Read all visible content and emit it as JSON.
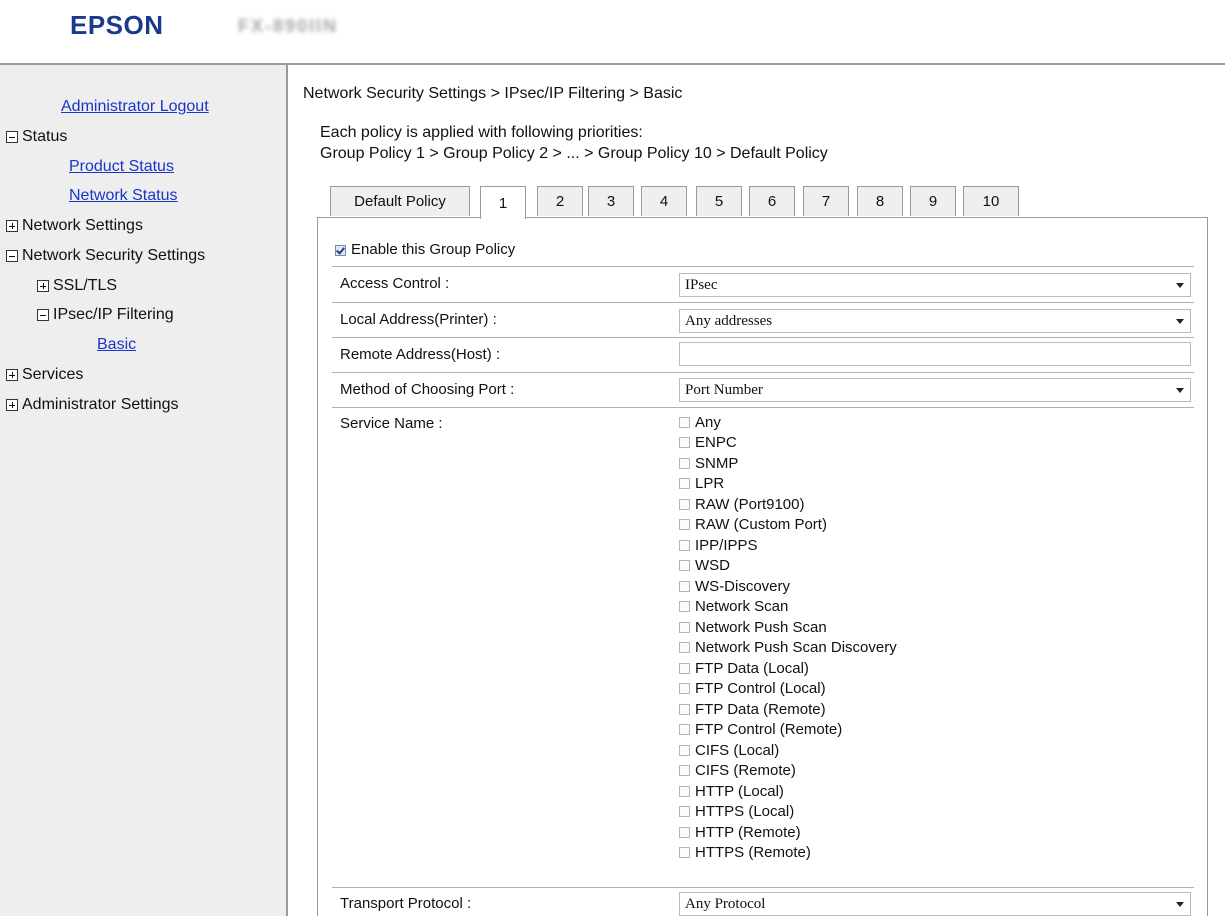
{
  "header": {
    "brand": "EPSON",
    "model": "FX-890IIN"
  },
  "sidebar": {
    "logout": "Administrator Logout",
    "items": [
      {
        "label": "Status"
      },
      {
        "label": "Product Status"
      },
      {
        "label": "Network Status"
      },
      {
        "label": "Network Settings"
      },
      {
        "label": "Network Security Settings"
      },
      {
        "label": "SSL/TLS"
      },
      {
        "label": "IPsec/IP Filtering"
      },
      {
        "label": "Basic"
      },
      {
        "label": "Services"
      },
      {
        "label": "Administrator Settings"
      }
    ]
  },
  "main": {
    "breadcrumb": "Network Security Settings > IPsec/IP Filtering > Basic",
    "intro1": "Each policy is applied with following priorities:",
    "intro2": "Group Policy 1 > Group Policy 2 > ... > Group Policy 10 > Default Policy",
    "tabs": [
      "Default Policy",
      "1",
      "2",
      "3",
      "4",
      "5",
      "6",
      "7",
      "8",
      "9",
      "10"
    ],
    "active_tab": "1",
    "enable_label": "Enable this Group Policy",
    "enable_checked": true,
    "access_control": {
      "label": "Access Control :",
      "value": "IPsec"
    },
    "local_address": {
      "label": "Local Address(Printer) :",
      "value": "Any addresses"
    },
    "remote_address": {
      "label": "Remote Address(Host) :",
      "value": ""
    },
    "port_method": {
      "label": "Method of Choosing Port :",
      "value": "Port Number"
    },
    "service_name": {
      "label": "Service Name :",
      "options": [
        "Any",
        "ENPC",
        "SNMP",
        "LPR",
        "RAW (Port9100)",
        "RAW (Custom Port)",
        "IPP/IPPS",
        "WSD",
        "WS-Discovery",
        "Network Scan",
        "Network Push Scan",
        "Network Push Scan Discovery",
        "FTP Data (Local)",
        "FTP Control (Local)",
        "FTP Data (Remote)",
        "FTP Control (Remote)",
        "CIFS (Local)",
        "CIFS (Remote)",
        "HTTP (Local)",
        "HTTPS (Local)",
        "HTTP (Remote)",
        "HTTPS (Remote)"
      ]
    },
    "transport_protocol": {
      "label": "Transport Protocol :",
      "value": "Any Protocol"
    }
  },
  "colors": {
    "brand": "#1c3a8c",
    "link": "#1a35c9",
    "sidebar_bg": "#eeeeee"
  }
}
